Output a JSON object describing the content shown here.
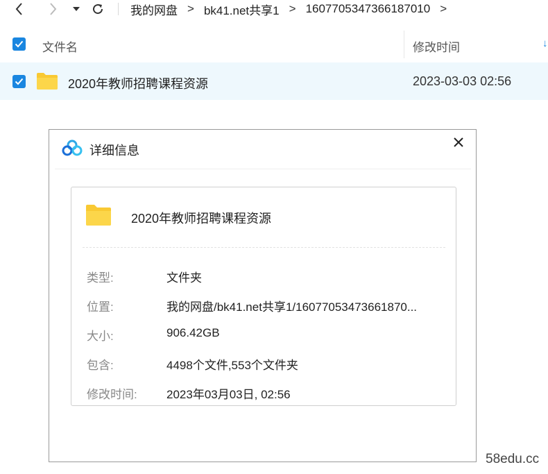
{
  "toolbar": {
    "back_icon": "chevron-left-icon",
    "forward_icon": "chevron-right-icon",
    "history_icon": "caret-down-icon",
    "refresh_icon": "refresh-icon",
    "breadcrumbs": [
      "我的网盘",
      "bk41.net共享1",
      "1607705347366187010"
    ],
    "separator": ">"
  },
  "list": {
    "header": {
      "name_label": "文件名",
      "time_label": "修改时间",
      "sort_icon": "sort-arrow-icon"
    },
    "rows": [
      {
        "name": "2020年教师招聘课程资源",
        "modified": "2023-03-03 02:56",
        "selected": true,
        "icon": "folder-icon"
      }
    ]
  },
  "dialog": {
    "title": "详细信息",
    "logo_icon": "cloud-logo-icon",
    "close_icon": "close-icon",
    "item_name": "2020年教师招聘课程资源",
    "properties": [
      {
        "label": "类型:",
        "value": "文件夹"
      },
      {
        "label": "位置:",
        "value": "我的网盘/bk41.net共享1/16077053473661870..."
      },
      {
        "label": "大小:",
        "value": "906.42GB"
      },
      {
        "label": "包含:",
        "value": "4498个文件,553个文件夹"
      },
      {
        "label": "修改时间:",
        "value": "2023年03月03日, 02:56"
      }
    ]
  },
  "watermark": "58edu.cc",
  "colors": {
    "accent": "#1a86e0",
    "folder": "#f9c933",
    "selected_row": "#eef8fd"
  }
}
